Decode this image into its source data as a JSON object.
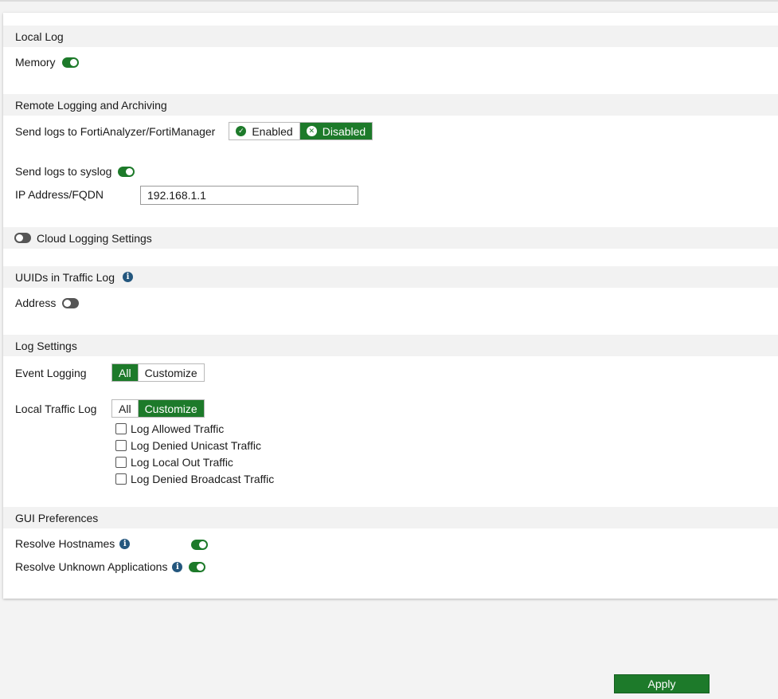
{
  "local_log": {
    "header": "Local Log",
    "memory_label": "Memory",
    "memory_enabled": true
  },
  "remote_logging": {
    "header": "Remote Logging and Archiving",
    "fortianalyzer_label": "Send logs to FortiAnalyzer/FortiManager",
    "enabled_label": "Enabled",
    "disabled_label": "Disabled",
    "fortianalyzer_selected": "Disabled",
    "syslog_label": "Send logs to syslog",
    "syslog_enabled": true,
    "ip_label": "IP Address/FQDN",
    "ip_value": "192.168.1.1"
  },
  "cloud_logging": {
    "label": "Cloud Logging Settings",
    "enabled": false
  },
  "uuids": {
    "header": "UUIDs in Traffic Log",
    "address_label": "Address",
    "address_enabled": false
  },
  "log_settings": {
    "header": "Log Settings",
    "event_logging_label": "Event Logging",
    "event_logging_options": [
      "All",
      "Customize"
    ],
    "event_logging_selected": "All",
    "local_traffic_label": "Local Traffic Log",
    "local_traffic_options": [
      "All",
      "Customize"
    ],
    "local_traffic_selected": "Customize",
    "checkboxes": [
      {
        "label": "Log Allowed Traffic",
        "checked": false
      },
      {
        "label": "Log Denied Unicast Traffic",
        "checked": false
      },
      {
        "label": "Log Local Out Traffic",
        "checked": false
      },
      {
        "label": "Log Denied Broadcast Traffic",
        "checked": false
      }
    ]
  },
  "gui_preferences": {
    "header": "GUI Preferences",
    "resolve_hostnames_label": "Resolve Hostnames",
    "resolve_hostnames_enabled": true,
    "resolve_apps_label": "Resolve Unknown Applications",
    "resolve_apps_enabled": true
  },
  "apply_label": "Apply",
  "icons": {
    "info": "info-icon",
    "check": "check-circle-icon",
    "x": "x-circle-icon"
  },
  "colors": {
    "accent_green": "#1d7a2a",
    "info_blue": "#24577e",
    "header_bg": "#f2f2f2"
  }
}
